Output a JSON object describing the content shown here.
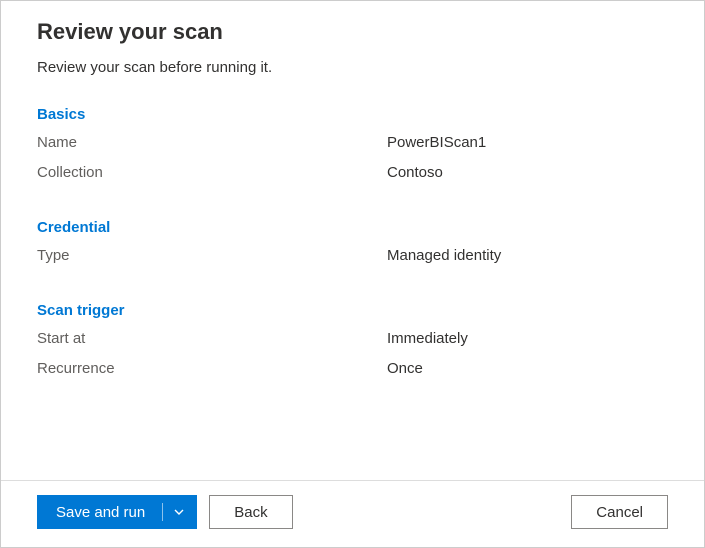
{
  "title": "Review your scan",
  "subtitle": "Review your scan before running it.",
  "sections": {
    "basics": {
      "heading": "Basics",
      "name_label": "Name",
      "name_value": "PowerBIScan1",
      "collection_label": "Collection",
      "collection_value": "Contoso"
    },
    "credential": {
      "heading": "Credential",
      "type_label": "Type",
      "type_value": "Managed identity"
    },
    "scan_trigger": {
      "heading": "Scan trigger",
      "start_at_label": "Start at",
      "start_at_value": "Immediately",
      "recurrence_label": "Recurrence",
      "recurrence_value": "Once"
    }
  },
  "footer": {
    "save_and_run": "Save and run",
    "back": "Back",
    "cancel": "Cancel"
  }
}
